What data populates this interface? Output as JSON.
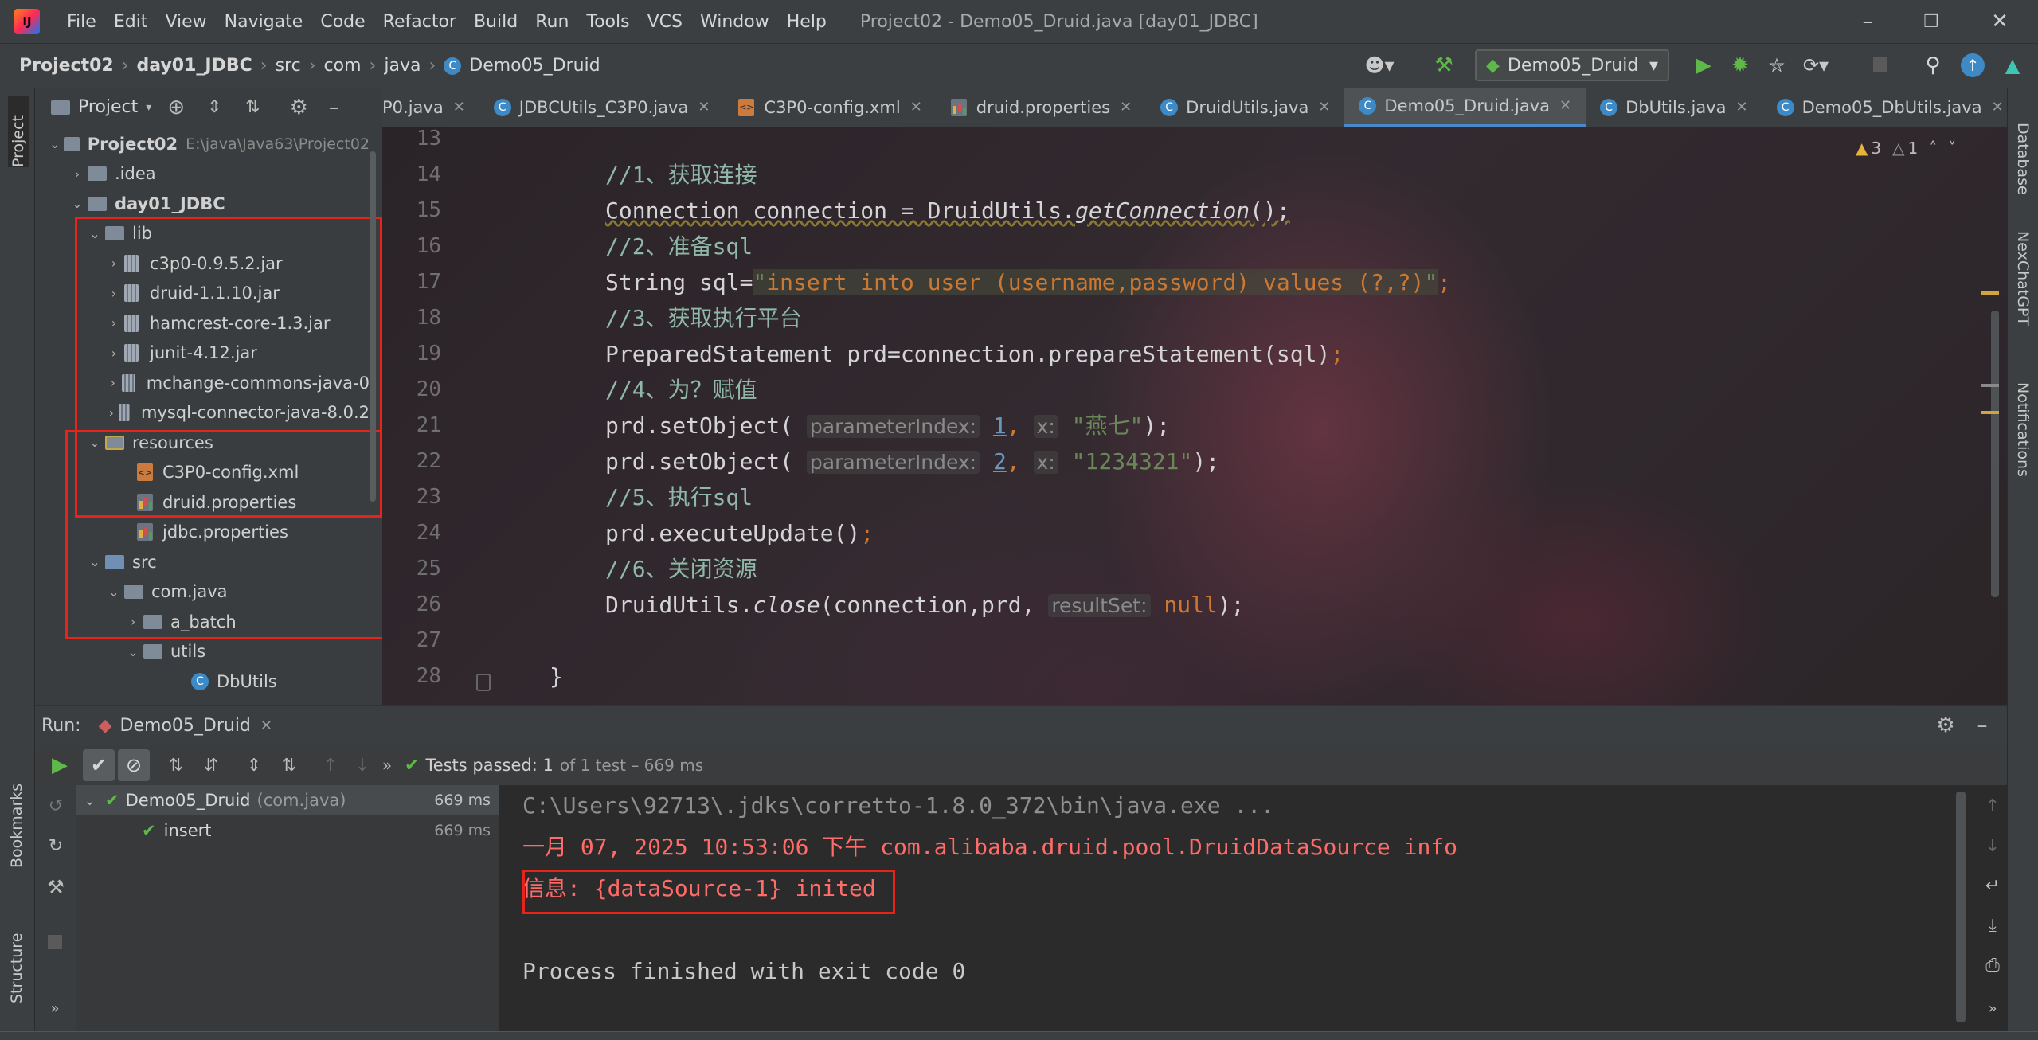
{
  "menu": [
    "File",
    "Edit",
    "View",
    "Navigate",
    "Code",
    "Refactor",
    "Build",
    "Run",
    "Tools",
    "VCS",
    "Window",
    "Help"
  ],
  "window_title": "Project02 - Demo05_Druid.java [day01_JDBC]",
  "breadcrumb": [
    "Project02",
    "day01_JDBC",
    "src",
    "com",
    "java",
    "Demo05_Druid"
  ],
  "run_config": "Demo05_Druid",
  "project_panel": {
    "title": "Project",
    "tree": [
      {
        "label": "Project02",
        "extra": "E:\\java\\Java63\\Project02"
      },
      {
        "label": ".idea"
      },
      {
        "label": "day01_JDBC"
      },
      {
        "label": "lib"
      },
      {
        "label": "c3p0-0.9.5.2.jar"
      },
      {
        "label": "druid-1.1.10.jar"
      },
      {
        "label": "hamcrest-core-1.3.jar"
      },
      {
        "label": "junit-4.12.jar"
      },
      {
        "label": "mchange-commons-java-0"
      },
      {
        "label": "mysql-connector-java-8.0.2"
      },
      {
        "label": "resources"
      },
      {
        "label": "C3P0-config.xml"
      },
      {
        "label": "druid.properties"
      },
      {
        "label": "jdbc.properties"
      },
      {
        "label": "src"
      },
      {
        "label": "com.java"
      },
      {
        "label": "a_batch"
      },
      {
        "label": "utils"
      },
      {
        "label": "DbUtils"
      }
    ]
  },
  "left_strip": {
    "project": "Project",
    "bookmarks": "Bookmarks",
    "structure": "Structure"
  },
  "right_strip": {
    "database": "Database",
    "nexchat": "NexChatGPT",
    "notifications": "Notifications"
  },
  "tabs": [
    "P0.java",
    "JDBCUtils_C3P0.java",
    "C3P0-config.xml",
    "druid.properties",
    "DruidUtils.java",
    "Demo05_Druid.java",
    "DbUtils.java",
    "Demo05_DbUtils.java"
  ],
  "inspections": {
    "warnings": "3",
    "weak": "1"
  },
  "editor": {
    "line_numbers": [
      "13",
      "14",
      "15",
      "16",
      "17",
      "18",
      "19",
      "20",
      "21",
      "22",
      "23",
      "24",
      "25",
      "26",
      "27",
      "28"
    ],
    "c14": "//1、获取连接",
    "c15a": "Connection connection = DruidUtils.",
    "c15b": "getConnection",
    "c15c": "();",
    "c16": "//2、准备sql",
    "c17a": "String sql=",
    "c17q1": "\"",
    "c17b": "insert into user (username,password) values (?,?)",
    "c17q2": "\"",
    "c17c": ";",
    "c18": "//3、获取执行平台",
    "c19a": "PreparedStatement prd=connection.prepareStatement(sql)",
    "c19b": ";",
    "c20": "//4、为？赋值",
    "c21a": "prd.setObject(",
    "c21h1": "parameterIndex:",
    "c21n": "1",
    "c21c": ",",
    "c21h2": "x:",
    "c21s": "\"燕七\"",
    "c21e": ");",
    "c22a": "prd.setObject(",
    "c22h1": "parameterIndex:",
    "c22n": "2",
    "c22c": ",",
    "c22h2": "x:",
    "c22s": "\"1234321\"",
    "c22e": ");",
    "c23": "//5、执行sql",
    "c24a": "prd.executeUpdate()",
    "c24b": ";",
    "c25": "//6、关闭资源",
    "c26a": "DruidUtils.",
    "c26b": "close",
    "c26c": "(connection,prd,",
    "c26h": "resultSet:",
    "c26n": "null",
    "c26e": ");",
    "c28": "}"
  },
  "run": {
    "label": "Run:",
    "tab": "Demo05_Druid",
    "tests_passed": "Tests passed: 1",
    "tests_detail": "of 1 test – 669 ms",
    "tree": [
      {
        "name": "Demo05_Druid",
        "pkg": "(com.java)",
        "time": "669 ms"
      },
      {
        "name": "insert",
        "time": "669 ms"
      }
    ],
    "console": [
      "C:\\Users\\92713\\.jdks\\corretto-1.8.0_372\\bin\\java.exe ...",
      "一月 07, 2025 10:53:06 下午 com.alibaba.druid.pool.DruidDataSource info",
      "信息: {dataSource-1} inited",
      "",
      "Process finished with exit code 0"
    ]
  },
  "colors": {
    "accent": "#4a88c7",
    "highlight_box": "#e8231a",
    "console_red": "#ff6b68",
    "pass_green": "#5fb84a"
  }
}
